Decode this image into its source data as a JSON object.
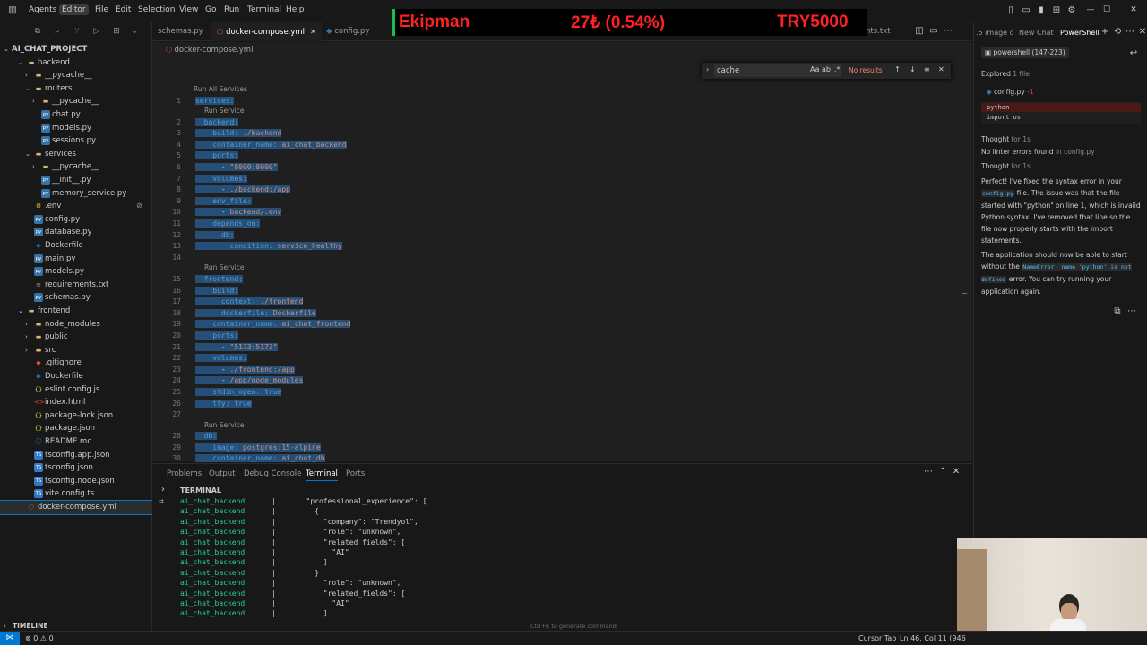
{
  "titlebar": {
    "menus": [
      "Agents",
      "Editor",
      "File",
      "Edit",
      "Selection",
      "View",
      "Go",
      "Run",
      "Terminal",
      "Help"
    ],
    "active_menu": "Editor"
  },
  "ticker": {
    "name": "Ekipman",
    "change": "27₺ (0.54%)",
    "price": "TRY5000"
  },
  "explorer": {
    "project": "AI_CHAT_PROJECT",
    "items": [
      {
        "label": "backend",
        "type": "folder",
        "depth": 1,
        "expanded": true
      },
      {
        "label": "__pycache__",
        "type": "folder",
        "depth": 2,
        "expanded": false
      },
      {
        "label": "routers",
        "type": "folder",
        "depth": 2,
        "expanded": true
      },
      {
        "label": "__pycache__",
        "type": "folder",
        "depth": 3,
        "expanded": false
      },
      {
        "label": "chat.py",
        "type": "py",
        "depth": 3
      },
      {
        "label": "models.py",
        "type": "py",
        "depth": 3
      },
      {
        "label": "sessions.py",
        "type": "py",
        "depth": 3
      },
      {
        "label": "services",
        "type": "folder",
        "depth": 2,
        "expanded": true
      },
      {
        "label": "__pycache__",
        "type": "folder",
        "depth": 3,
        "expanded": false
      },
      {
        "label": "__init__.py",
        "type": "py",
        "depth": 3
      },
      {
        "label": "memory_service.py",
        "type": "py",
        "depth": 3
      },
      {
        "label": ".env",
        "type": "env",
        "depth": 2
      },
      {
        "label": "config.py",
        "type": "py",
        "depth": 2
      },
      {
        "label": "database.py",
        "type": "py",
        "depth": 2
      },
      {
        "label": "Dockerfile",
        "type": "docker",
        "depth": 2
      },
      {
        "label": "main.py",
        "type": "py",
        "depth": 2
      },
      {
        "label": "models.py",
        "type": "py",
        "depth": 2
      },
      {
        "label": "requirements.txt",
        "type": "txt",
        "depth": 2
      },
      {
        "label": "schemas.py",
        "type": "py",
        "depth": 2
      },
      {
        "label": "frontend",
        "type": "folder",
        "depth": 1,
        "expanded": true
      },
      {
        "label": "node_modules",
        "type": "folder",
        "depth": 2,
        "expanded": false
      },
      {
        "label": "public",
        "type": "folder",
        "depth": 2,
        "expanded": false
      },
      {
        "label": "src",
        "type": "folder",
        "depth": 2,
        "expanded": false
      },
      {
        "label": ".gitignore",
        "type": "git",
        "depth": 2
      },
      {
        "label": "Dockerfile",
        "type": "docker",
        "depth": 2
      },
      {
        "label": "eslint.config.js",
        "type": "json",
        "depth": 2
      },
      {
        "label": "index.html",
        "type": "html",
        "depth": 2
      },
      {
        "label": "package-lock.json",
        "type": "json",
        "depth": 2
      },
      {
        "label": "package.json",
        "type": "json",
        "depth": 2
      },
      {
        "label": "README.md",
        "type": "md",
        "depth": 2
      },
      {
        "label": "tsconfig.app.json",
        "type": "ts",
        "depth": 2
      },
      {
        "label": "tsconfig.json",
        "type": "ts",
        "depth": 2
      },
      {
        "label": "tsconfig.node.json",
        "type": "ts",
        "depth": 2
      },
      {
        "label": "vite.config.ts",
        "type": "ts",
        "depth": 2
      },
      {
        "label": "docker-compose.yml",
        "type": "yml",
        "depth": 1,
        "selected": true
      }
    ],
    "timeline": "TIMELINE"
  },
  "tabs": [
    {
      "label": "schemas.py",
      "active": false
    },
    {
      "label": "docker-compose.yml",
      "active": true
    },
    {
      "label": "config.py",
      "active": false
    },
    {
      "label": "nts.txt",
      "active": false
    }
  ],
  "breadcrumb": "docker-compose.yml",
  "find": {
    "query": "cache",
    "result": "No results",
    "case_label": "Aa",
    "word_label": "ab",
    "regex_label": ".*"
  },
  "codelens": {
    "run_all": "Run All Services",
    "run": "Run Service"
  },
  "code": [
    {
      "n": "1",
      "text": "services:"
    },
    {
      "n": "2",
      "text": "  backend:"
    },
    {
      "n": "3",
      "text": "    build: ./backend"
    },
    {
      "n": "4",
      "text": "    container_name: ai_chat_backend"
    },
    {
      "n": "5",
      "text": "    ports:"
    },
    {
      "n": "6",
      "text": "      - \"8000:8000\""
    },
    {
      "n": "7",
      "text": "    volumes:"
    },
    {
      "n": "8",
      "text": "      - ./backend:/app"
    },
    {
      "n": "9",
      "text": "    env_file:"
    },
    {
      "n": "10",
      "text": "      - backend/.env"
    },
    {
      "n": "11",
      "text": "    depends_on:"
    },
    {
      "n": "12",
      "text": "      db:"
    },
    {
      "n": "13",
      "text": "        condition: service_healthy"
    },
    {
      "n": "14",
      "text": ""
    },
    {
      "n": "15",
      "text": "  frontend:"
    },
    {
      "n": "16",
      "text": "    build:"
    },
    {
      "n": "17",
      "text": "      context: ./frontend"
    },
    {
      "n": "18",
      "text": "      dockerfile: Dockerfile"
    },
    {
      "n": "19",
      "text": "    container_name: ai_chat_frontend"
    },
    {
      "n": "20",
      "text": "    ports:"
    },
    {
      "n": "21",
      "text": "      - \"5173:5173\""
    },
    {
      "n": "22",
      "text": "    volumes:"
    },
    {
      "n": "23",
      "text": "      - ./frontend:/app"
    },
    {
      "n": "24",
      "text": "      - /app/node_modules"
    },
    {
      "n": "25",
      "text": "    stdin_open: true"
    },
    {
      "n": "26",
      "text": "    tty: true"
    },
    {
      "n": "27",
      "text": ""
    },
    {
      "n": "28",
      "text": "  db:"
    },
    {
      "n": "29",
      "text": "    image: postgres:15-alpine"
    },
    {
      "n": "30",
      "text": "    container_name: ai_chat_db"
    }
  ],
  "panel": {
    "tabs": [
      "Problems",
      "Output",
      "Debug Console",
      "Terminal",
      "Ports"
    ],
    "active_tab": "Terminal",
    "terminal_title": "TERMINAL",
    "hint": "Ctrl+K to generate command",
    "lines": [
      {
        "svc": "ai_chat_backend",
        "text": "|       \"professional_experience\": ["
      },
      {
        "svc": "ai_chat_backend",
        "text": "|         {"
      },
      {
        "svc": "ai_chat_backend",
        "text": "|           \"company\": \"Trendyol\","
      },
      {
        "svc": "ai_chat_backend",
        "text": "|           \"role\": \"unknown\","
      },
      {
        "svc": "ai_chat_backend",
        "text": "|           \"related_fields\": ["
      },
      {
        "svc": "ai_chat_backend",
        "text": "|             \"AI\""
      },
      {
        "svc": "ai_chat_backend",
        "text": "|           ]"
      },
      {
        "svc": "ai_chat_backend",
        "text": "|         }"
      },
      {
        "svc": "ai_chat_backend",
        "text": "|           \"role\": \"unknown\","
      },
      {
        "svc": "ai_chat_backend",
        "text": "|           \"related_fields\": ["
      },
      {
        "svc": "ai_chat_backend",
        "text": "|             \"AI\""
      },
      {
        "svc": "ai_chat_backend",
        "text": "|           ]"
      }
    ]
  },
  "chat": {
    "tabs": [
      ".5 image c",
      "New Chat",
      "PowerShell"
    ],
    "active_tab": "PowerShell",
    "session": "powershell (147-223)",
    "explored": "Explored",
    "explored_count": "1 file",
    "file": "config.py",
    "file_badge": "-1",
    "diff_removed": "python",
    "diff_kept": "import os",
    "thought1": "Thought",
    "thought1_time": "for 1s",
    "lint": "No linter errors found",
    "lint_in": "in config.py",
    "thought2": "Thought",
    "thought2_time": "for 1s",
    "para1_a": "Perfect! I've fixed the syntax error in your",
    "para1_code": "config.py",
    "para1_b": "file. The issue was that the file started with \"python\" on line 1, which is invalid Python syntax. I've removed that line so the file now properly starts with the import statements.",
    "para2_a": "The application should now be able to start without the",
    "para2_code": "NameError: name 'python' is not defined",
    "para2_b": "error. You can try running your application again."
  },
  "statusbar": {
    "left": "⊗ 0 ⚠ 0",
    "cursor_tab": "Cursor Tab",
    "position": "Ln 46, Col 11 (946"
  }
}
